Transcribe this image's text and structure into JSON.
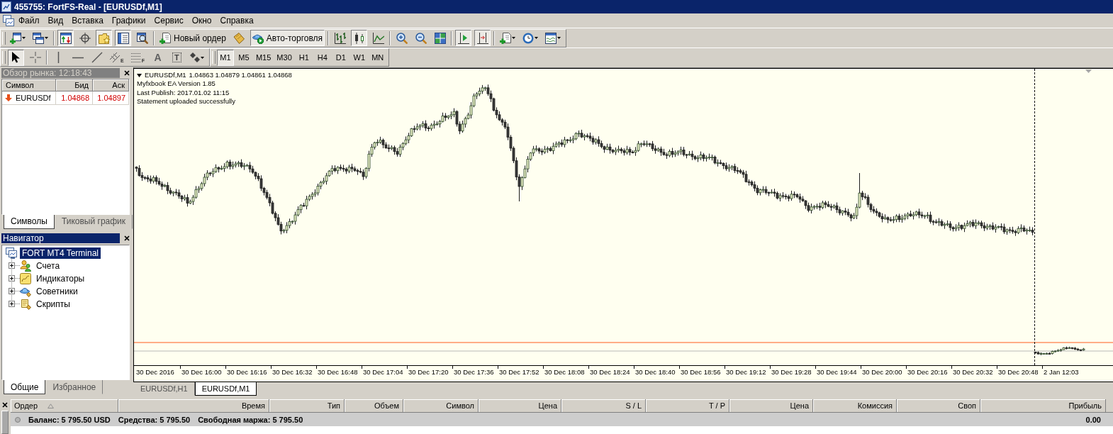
{
  "window": {
    "title": "455755: FortFS-Real - [EURUSDf,M1]"
  },
  "menu": [
    "Файл",
    "Вид",
    "Вставка",
    "Графики",
    "Сервис",
    "Окно",
    "Справка"
  ],
  "toolbar": {
    "groups": [
      [
        {
          "kind": "dropdown",
          "pressed": false
        },
        {
          "kind": "dropdown",
          "pressed": false
        }
      ],
      [
        {
          "kind": "icon",
          "pressed": true
        },
        {
          "kind": "icon",
          "pressed": false
        },
        {
          "kind": "icon",
          "pressed": true
        },
        {
          "kind": "icon",
          "pressed": true
        },
        {
          "kind": "icon",
          "pressed": false
        }
      ],
      [
        {
          "kind": "labeled",
          "label": "Новый ордер",
          "pressed": false
        },
        {
          "kind": "icon",
          "pressed": false
        },
        {
          "kind": "labeled",
          "label": "Авто-торговля",
          "pressed": true
        }
      ],
      [
        {
          "kind": "icon",
          "pressed": false
        },
        {
          "kind": "icon",
          "pressed": true
        },
        {
          "kind": "icon",
          "pressed": false
        }
      ],
      [
        {
          "kind": "icon",
          "pressed": false
        },
        {
          "kind": "icon",
          "pressed": false
        },
        {
          "kind": "icon",
          "pressed": false
        }
      ],
      [
        {
          "kind": "icon",
          "pressed": true
        },
        {
          "kind": "icon",
          "pressed": true
        }
      ],
      [
        {
          "kind": "dropdown",
          "pressed": false
        },
        {
          "kind": "dropdown",
          "pressed": false
        },
        {
          "kind": "dropdown",
          "pressed": false
        }
      ]
    ]
  },
  "toolbar2": {
    "groups": [
      [
        {
          "kind": "icon",
          "pressed": true
        },
        {
          "kind": "icon",
          "pressed": false
        }
      ],
      [
        {
          "kind": "icon",
          "pressed": false
        },
        {
          "kind": "icon",
          "pressed": false
        },
        {
          "kind": "icon",
          "pressed": false
        },
        {
          "kind": "badged",
          "badge": "E",
          "pressed": false
        },
        {
          "kind": "badged",
          "badge": "F",
          "pressed": false
        },
        {
          "kind": "glyph",
          "glyph": "A",
          "pressed": false
        },
        {
          "kind": "framed",
          "glyph": "T",
          "pressed": false
        },
        {
          "kind": "dropdown",
          "pressed": false
        }
      ]
    ],
    "periods": [
      {
        "label": "M1",
        "selected": true
      },
      {
        "label": "M5",
        "selected": false
      },
      {
        "label": "M15",
        "selected": false
      },
      {
        "label": "M30",
        "selected": false
      },
      {
        "label": "H1",
        "selected": false
      },
      {
        "label": "H4",
        "selected": false
      },
      {
        "label": "D1",
        "selected": false
      },
      {
        "label": "W1",
        "selected": false
      },
      {
        "label": "MN",
        "selected": false
      }
    ]
  },
  "market_watch": {
    "title": "Обзор рынка: 12:18:43",
    "active": false,
    "columns": [
      "Символ",
      "Бид",
      "Аск"
    ],
    "rows": [
      {
        "symbol": "EURUSDf",
        "bid": "1.04868",
        "ask": "1.04897",
        "falling": true
      }
    ],
    "tabs": [
      {
        "label": "Символы",
        "selected": true
      },
      {
        "label": "Тиковый график",
        "selected": false
      }
    ]
  },
  "navigator": {
    "title": "Навигатор",
    "active": true,
    "tree": [
      {
        "label": "FORT MT4 Terminal",
        "selected": true,
        "children": [
          {
            "label": "Счета",
            "selected": false,
            "expanded": false
          },
          {
            "label": "Индикаторы",
            "selected": false,
            "expanded": false
          },
          {
            "label": "Советники",
            "selected": false,
            "expanded": false
          },
          {
            "label": "Скрипты",
            "selected": false,
            "expanded": false
          }
        ]
      }
    ],
    "tabs": [
      {
        "label": "Общие",
        "selected": true
      },
      {
        "label": "Избранное",
        "selected": false
      }
    ]
  },
  "chart": {
    "legend": {
      "symbol": "EURUSDf,M1",
      "prices": "1.04863 1.04879 1.04861 1.04868"
    },
    "comments": [
      "Myfxbook EA Version 1.85",
      "Last Publish: 2017.01.02 11:15",
      "Statement uploaded successfully"
    ],
    "time_labels": [
      "30 Dec 2016",
      "30 Dec 16:00",
      "30 Dec 16:16",
      "30 Dec 16:32",
      "30 Dec 16:48",
      "30 Dec 17:04",
      "30 Dec 17:20",
      "30 Dec 17:36",
      "30 Dec 17:52",
      "30 Dec 18:08",
      "30 Dec 18:24",
      "30 Dec 18:40",
      "30 Dec 18:56",
      "30 Dec 19:12",
      "30 Dec 19:28",
      "30 Dec 19:44",
      "30 Dec 20:00",
      "30 Dec 20:16",
      "30 Dec 20:32",
      "30 Dec 20:48",
      "2 Jan 12:03"
    ]
  },
  "chart_tabs": [
    {
      "label": "EURUSDf,H1",
      "selected": false
    },
    {
      "label": "EURUSDf,M1",
      "selected": true
    }
  ],
  "terminal": {
    "columns": [
      {
        "label": "Ордер",
        "sorted": true
      },
      {
        "label": "Время",
        "sorted": false
      },
      {
        "label": "Тип",
        "sorted": false
      },
      {
        "label": "Объем",
        "sorted": false
      },
      {
        "label": "Символ",
        "sorted": false
      },
      {
        "label": "Цена",
        "sorted": false
      },
      {
        "label": "S / L",
        "sorted": false
      },
      {
        "label": "T / P",
        "sorted": false
      },
      {
        "label": "Цена",
        "sorted": false
      },
      {
        "label": "Комиссия",
        "sorted": false
      },
      {
        "label": "Своп",
        "sorted": false
      },
      {
        "label": "Прибыль",
        "sorted": false
      }
    ],
    "summary": [
      "Баланс: 5 795.50 USD",
      "Средства: 5 795.50",
      "Свободная маржа: 5 795.50"
    ],
    "profit": "0.00"
  }
}
